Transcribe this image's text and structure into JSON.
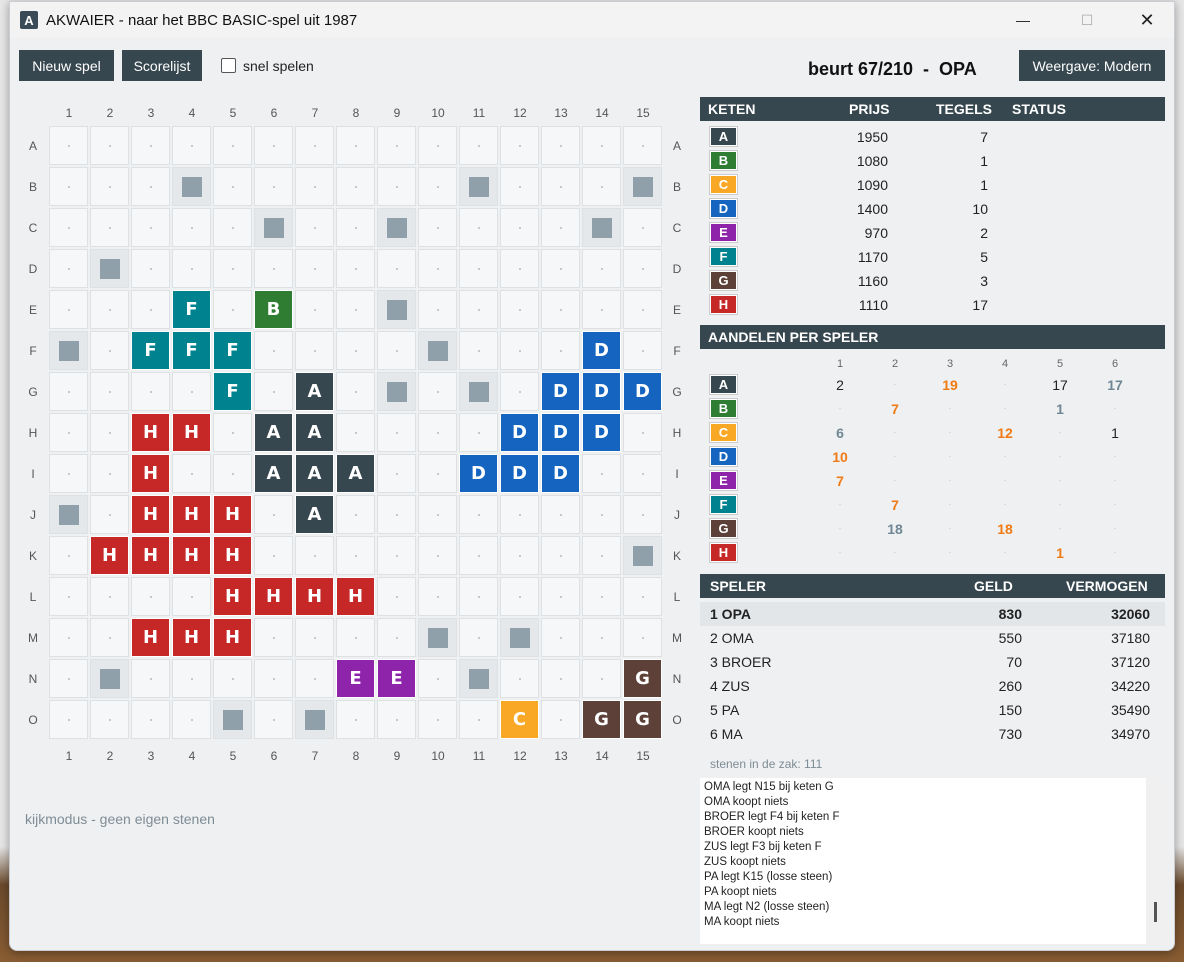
{
  "window": {
    "title": "AKWAIER  -  naar het BBC BASIC-spel uit 1987",
    "app_icon": "A"
  },
  "toolbar": {
    "new_game": "Nieuw spel",
    "scores": "Scorelijst",
    "fast_play": "snel spelen",
    "view_mode": "Weergave: Modern",
    "turn": "beurt 67/210  -  OPA"
  },
  "colors": {
    "A": "#37474f",
    "B": "#2e7d32",
    "C": "#f9a825",
    "D": "#1565c0",
    "E": "#8e24aa",
    "F": "#00838f",
    "G": "#5d4037",
    "H": "#c62828"
  },
  "board": {
    "cols": [
      "1",
      "2",
      "3",
      "4",
      "5",
      "6",
      "7",
      "8",
      "9",
      "10",
      "11",
      "12",
      "13",
      "14",
      "15"
    ],
    "rows": [
      "A",
      "B",
      "C",
      "D",
      "E",
      "F",
      "G",
      "H",
      "I",
      "J",
      "K",
      "L",
      "M",
      "N",
      "O"
    ],
    "grid": [
      "...............",
      "...x......x...x",
      ".....x..x....x.",
      ".x.............",
      "...F.B..x......",
      "x.FFF....x...D.",
      "....F.A.x.x.DDD",
      "..HH.AA....DDD.",
      "..H..AAA..DDD..",
      "x.HHH.A........",
      ".HHHH.........x",
      "....HHHH.......",
      "..HHH....x.x...",
      ".x.....EE.x...G",
      "....x.x....C.GG"
    ],
    "hint": "kijkmodus - geen eigen stenen"
  },
  "chains": {
    "headers": {
      "chain": "KETEN",
      "price": "PRIJS",
      "tiles": "TEGELS",
      "status": "STATUS"
    },
    "rows": [
      {
        "id": "A",
        "price": "1950",
        "tiles": "7"
      },
      {
        "id": "B",
        "price": "1080",
        "tiles": "1"
      },
      {
        "id": "C",
        "price": "1090",
        "tiles": "1"
      },
      {
        "id": "D",
        "price": "1400",
        "tiles": "10"
      },
      {
        "id": "E",
        "price": "970",
        "tiles": "2"
      },
      {
        "id": "F",
        "price": "1170",
        "tiles": "5"
      },
      {
        "id": "G",
        "price": "1160",
        "tiles": "3"
      },
      {
        "id": "H",
        "price": "1110",
        "tiles": "17"
      }
    ]
  },
  "shares": {
    "header": "AANDELEN PER SPELER",
    "player_cols": [
      "1",
      "2",
      "3",
      "4",
      "5",
      "6"
    ],
    "rows": [
      {
        "id": "A",
        "vals": [
          [
            "2",
            "own"
          ],
          [
            ".",
            "dot"
          ],
          [
            "19",
            "maj"
          ],
          [
            ".",
            "dot"
          ],
          [
            "17",
            "own"
          ],
          [
            "17",
            "sec"
          ]
        ]
      },
      {
        "id": "B",
        "vals": [
          [
            ".",
            "dot"
          ],
          [
            "7",
            "maj"
          ],
          [
            ".",
            "dot"
          ],
          [
            ".",
            "dot"
          ],
          [
            "1",
            "sec"
          ],
          [
            ".",
            "dot"
          ]
        ]
      },
      {
        "id": "C",
        "vals": [
          [
            "6",
            "sec"
          ],
          [
            ".",
            "dot"
          ],
          [
            ".",
            "dot"
          ],
          [
            "12",
            "maj"
          ],
          [
            ".",
            "dot"
          ],
          [
            "1",
            "own"
          ]
        ]
      },
      {
        "id": "D",
        "vals": [
          [
            "10",
            "maj"
          ],
          [
            ".",
            "dot"
          ],
          [
            ".",
            "dot"
          ],
          [
            ".",
            "dot"
          ],
          [
            ".",
            "dot"
          ],
          [
            ".",
            "dot"
          ]
        ]
      },
      {
        "id": "E",
        "vals": [
          [
            "7",
            "maj"
          ],
          [
            ".",
            "dot"
          ],
          [
            ".",
            "dot"
          ],
          [
            ".",
            "dot"
          ],
          [
            ".",
            "dot"
          ],
          [
            ".",
            "dot"
          ]
        ]
      },
      {
        "id": "F",
        "vals": [
          [
            ".",
            "dot"
          ],
          [
            "7",
            "maj"
          ],
          [
            ".",
            "dot"
          ],
          [
            ".",
            "dot"
          ],
          [
            ".",
            "dot"
          ],
          [
            ".",
            "dot"
          ]
        ]
      },
      {
        "id": "G",
        "vals": [
          [
            ".",
            "dot"
          ],
          [
            "18",
            "sec"
          ],
          [
            ".",
            "dot"
          ],
          [
            "18",
            "maj"
          ],
          [
            ".",
            "dot"
          ],
          [
            ".",
            "dot"
          ]
        ]
      },
      {
        "id": "H",
        "vals": [
          [
            ".",
            "dot"
          ],
          [
            ".",
            "dot"
          ],
          [
            ".",
            "dot"
          ],
          [
            ".",
            "dot"
          ],
          [
            "1",
            "maj"
          ],
          [
            ".",
            "dot"
          ]
        ]
      }
    ]
  },
  "players": {
    "headers": {
      "player": "SPELER",
      "money": "GELD",
      "worth": "VERMOGEN"
    },
    "rows": [
      {
        "name": "1 OPA",
        "money": "830",
        "worth": "32060"
      },
      {
        "name": "2 OMA",
        "money": "550",
        "worth": "37180"
      },
      {
        "name": "3 BROER",
        "money": "70",
        "worth": "37120"
      },
      {
        "name": "4 ZUS",
        "money": "260",
        "worth": "34220"
      },
      {
        "name": "5 PA",
        "money": "150",
        "worth": "35490"
      },
      {
        "name": "6 MA",
        "money": "730",
        "worth": "34970"
      }
    ],
    "bag": "stenen in de zak: 111"
  },
  "log": [
    "OMA legt N15 bij keten G",
    "OMA koopt niets",
    "BROER legt F4 bij keten F",
    "BROER koopt niets",
    "ZUS legt F3 bij keten F",
    "ZUS koopt niets",
    "PA legt K15 (losse steen)",
    "PA koopt niets",
    "MA legt N2 (losse steen)",
    "MA koopt niets"
  ]
}
